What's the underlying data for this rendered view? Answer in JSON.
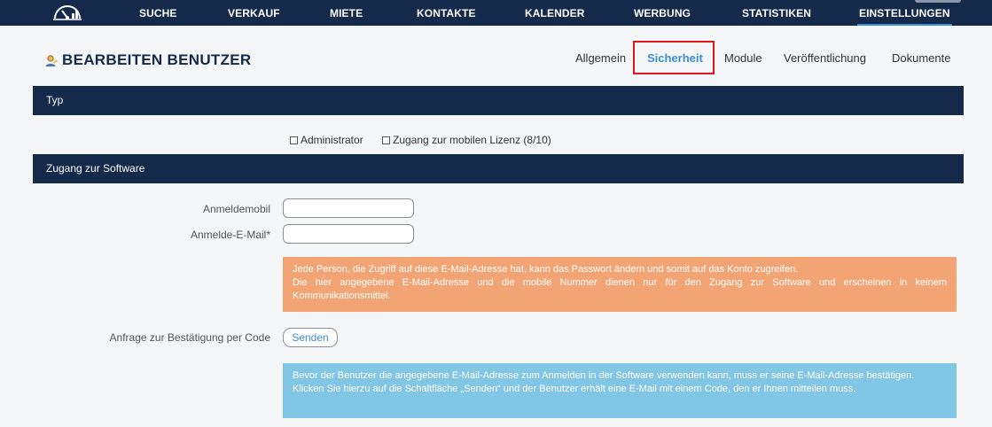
{
  "colors": {
    "nav_background": "#15294b",
    "accent": "#3a8fd6",
    "highlight_border": "#e0161c",
    "warning_notice": "#f2a475",
    "info_notice": "#82c6e6"
  },
  "topnav": {
    "logo_icon": "speedometer-icon",
    "items": [
      {
        "label": "SUCHE"
      },
      {
        "label": "VERKAUF"
      },
      {
        "label": "MIETE"
      },
      {
        "label": "KONTAKTE"
      },
      {
        "label": "KALENDER"
      },
      {
        "label": "WERBUNG"
      },
      {
        "label": "STATISTIKEN"
      },
      {
        "label": "EINSTELLUNGEN",
        "active": true
      }
    ]
  },
  "page": {
    "title": "BEARBEITEN BENUTZER",
    "title_icon": "user-edit-icon",
    "tabs": [
      {
        "label": "Allgemein"
      },
      {
        "label": "Sicherheit",
        "active": true
      },
      {
        "label": "Module"
      },
      {
        "label": "Veröffentlichung"
      },
      {
        "label": "Dokumente"
      }
    ]
  },
  "sections": {
    "typ": {
      "title": "Typ",
      "checkboxes": [
        {
          "label": "Administrator",
          "checked": false
        },
        {
          "label": "Zugang zur mobilen Lizenz (8/10)",
          "checked": false
        }
      ]
    },
    "access": {
      "title": "Zugang zur Software",
      "fields": {
        "mobile": {
          "label": "Anmeldemobil",
          "value": ""
        },
        "email": {
          "label": "Anmelde-E-Mail*",
          "value": ""
        }
      },
      "email_notice": {
        "line1": "Jede Person, die Zugriff auf diese E-Mail-Adresse hat, kann das Passwort ändern und somit auf das Konto zugreifen.",
        "line2": "Die hier angegebene E-Mail-Adresse und die mobile Nummer dienen nur für den Zugang zur Software und erscheinen in keinem Kommunikationsmittel."
      },
      "confirmation": {
        "label": "Anfrage zur Bestätigung per Code",
        "button_label": "Senden"
      },
      "info_notice": {
        "line1": "Bevor der Benutzer die angegebene E-Mail-Adresse zum Anmelden in der Software verwenden kann, muss er seine E-Mail-Adresse bestätigen.",
        "line2": "Klicken Sie hierzu auf die Schaltfläche „Senden“ und der Benutzer erhält eine E-Mail mit einem Code, den er Ihnen mitteilen muss."
      }
    }
  }
}
